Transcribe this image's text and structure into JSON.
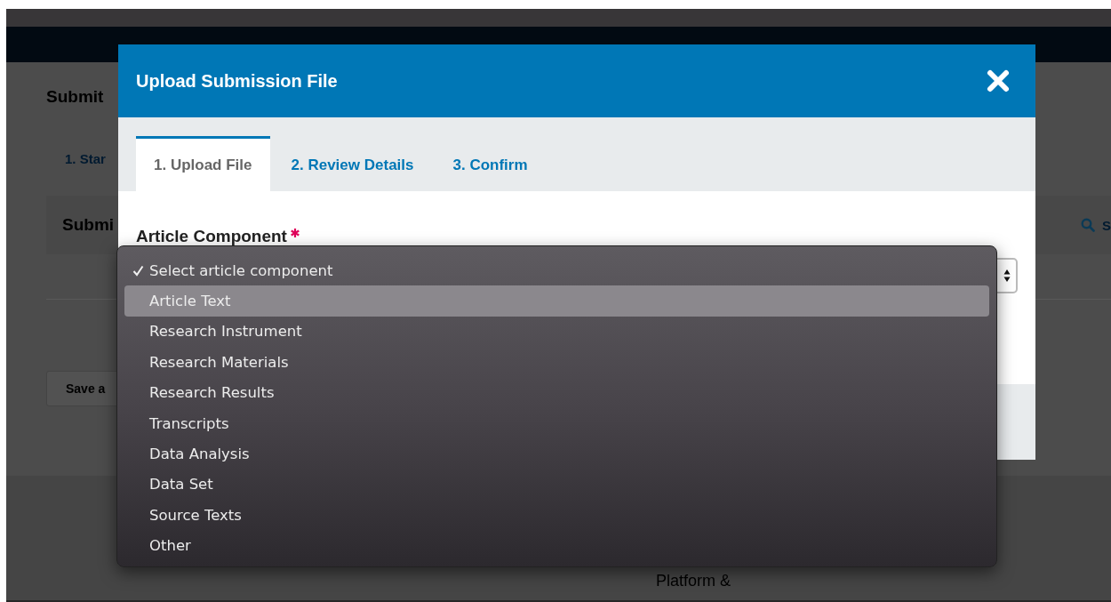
{
  "background_page": {
    "heading": "Submit",
    "steps_tab": "1. Star",
    "section_title": "Submi",
    "search_icon_label": "S",
    "save_button": "Save a",
    "footer_text": "Platform &"
  },
  "modal": {
    "title": "Upload Submission File",
    "tabs": [
      {
        "label": "1. Upload File",
        "selected": true
      },
      {
        "label": "2. Review Details",
        "selected": false
      },
      {
        "label": "3. Confirm",
        "selected": false
      }
    ],
    "field": {
      "label": "Article Component",
      "required": true
    }
  },
  "dropdown": {
    "options": [
      {
        "label": "Select article component",
        "selected": true,
        "highlighted": false
      },
      {
        "label": "Article Text",
        "selected": false,
        "highlighted": true
      },
      {
        "label": "Research Instrument",
        "selected": false,
        "highlighted": false
      },
      {
        "label": "Research Materials",
        "selected": false,
        "highlighted": false
      },
      {
        "label": "Research Results",
        "selected": false,
        "highlighted": false
      },
      {
        "label": "Transcripts",
        "selected": false,
        "highlighted": false
      },
      {
        "label": "Data Analysis",
        "selected": false,
        "highlighted": false
      },
      {
        "label": "Data Set",
        "selected": false,
        "highlighted": false
      },
      {
        "label": "Source Texts",
        "selected": false,
        "highlighted": false
      },
      {
        "label": "Other",
        "selected": false,
        "highlighted": false
      }
    ]
  }
}
